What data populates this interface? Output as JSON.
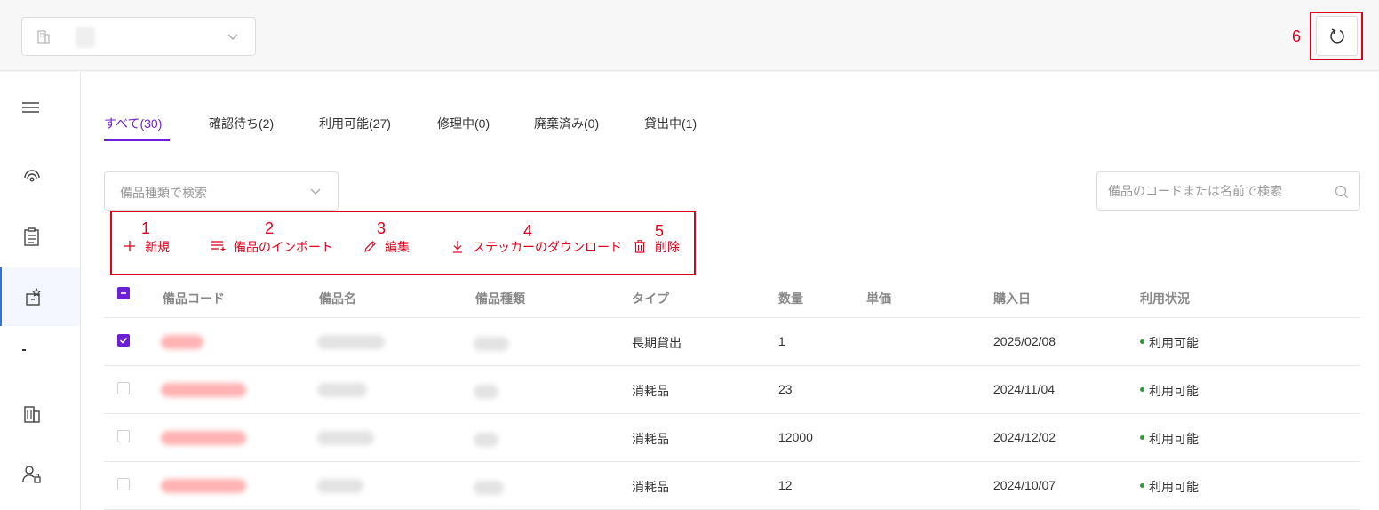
{
  "annotations": {
    "n1": "1",
    "n2": "2",
    "n3": "3",
    "n4": "4",
    "n5": "5",
    "n6": "6",
    "color": "#e0001b"
  },
  "tabs": [
    {
      "label": "すべて(30)",
      "active": true
    },
    {
      "label": "確認待ち(2)"
    },
    {
      "label": "利用可能(27)"
    },
    {
      "label": "修理中(0)"
    },
    {
      "label": "廃棄済み(0)"
    },
    {
      "label": "貸出中(1)"
    }
  ],
  "filters": {
    "type_placeholder": "備品種類で検索",
    "search_placeholder": "備品のコードまたは名前で検索"
  },
  "toolbar": {
    "new": "新規",
    "import": "備品のインポート",
    "edit": "編集",
    "download": "ステッカーのダウンロード",
    "delete": "削除"
  },
  "table": {
    "headers": {
      "code": "備品コード",
      "name": "備品名",
      "category": "備品種類",
      "type": "タイプ",
      "qty": "数量",
      "price": "単価",
      "date": "購入日",
      "status": "利用状況"
    },
    "rows": [
      {
        "type": "長期貸出",
        "qty": "1",
        "date": "2025/02/08",
        "status": "利用可能",
        "checked": true
      },
      {
        "type": "消耗品",
        "qty": "23",
        "date": "2024/11/04",
        "status": "利用可能",
        "checked": false
      },
      {
        "type": "消耗品",
        "qty": "12000",
        "date": "2024/12/02",
        "status": "利用可能",
        "checked": false
      },
      {
        "type": "消耗品",
        "qty": "12",
        "date": "2024/10/07",
        "status": "利用可能",
        "checked": false
      }
    ]
  },
  "colors": {
    "accent": "#6b1fd6",
    "status_ok": "#2e9a3a"
  }
}
